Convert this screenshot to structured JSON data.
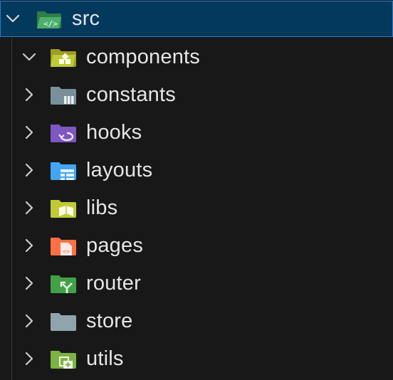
{
  "explorer": {
    "root": {
      "label": "src",
      "expanded": true,
      "icon": "folder-src-open-icon",
      "color": "#3f9b5c"
    },
    "items": [
      {
        "label": "components",
        "expanded": true,
        "icon": "folder-components-open-icon",
        "color": "#c0ca33"
      },
      {
        "label": "constants",
        "expanded": false,
        "icon": "folder-constants-icon",
        "color": "#78909c"
      },
      {
        "label": "hooks",
        "expanded": false,
        "icon": "folder-hooks-icon",
        "color": "#7e57c2"
      },
      {
        "label": "layouts",
        "expanded": false,
        "icon": "folder-layouts-icon",
        "color": "#42a5f5"
      },
      {
        "label": "libs",
        "expanded": false,
        "icon": "folder-libs-icon",
        "color": "#c0ca33"
      },
      {
        "label": "pages",
        "expanded": false,
        "icon": "folder-pages-icon",
        "color": "#ff7043"
      },
      {
        "label": "router",
        "expanded": false,
        "icon": "folder-router-icon",
        "color": "#43a047"
      },
      {
        "label": "store",
        "expanded": false,
        "icon": "folder-store-icon",
        "color": "#90a4ae"
      },
      {
        "label": "utils",
        "expanded": false,
        "icon": "folder-utils-icon",
        "color": "#7cb342"
      }
    ]
  }
}
